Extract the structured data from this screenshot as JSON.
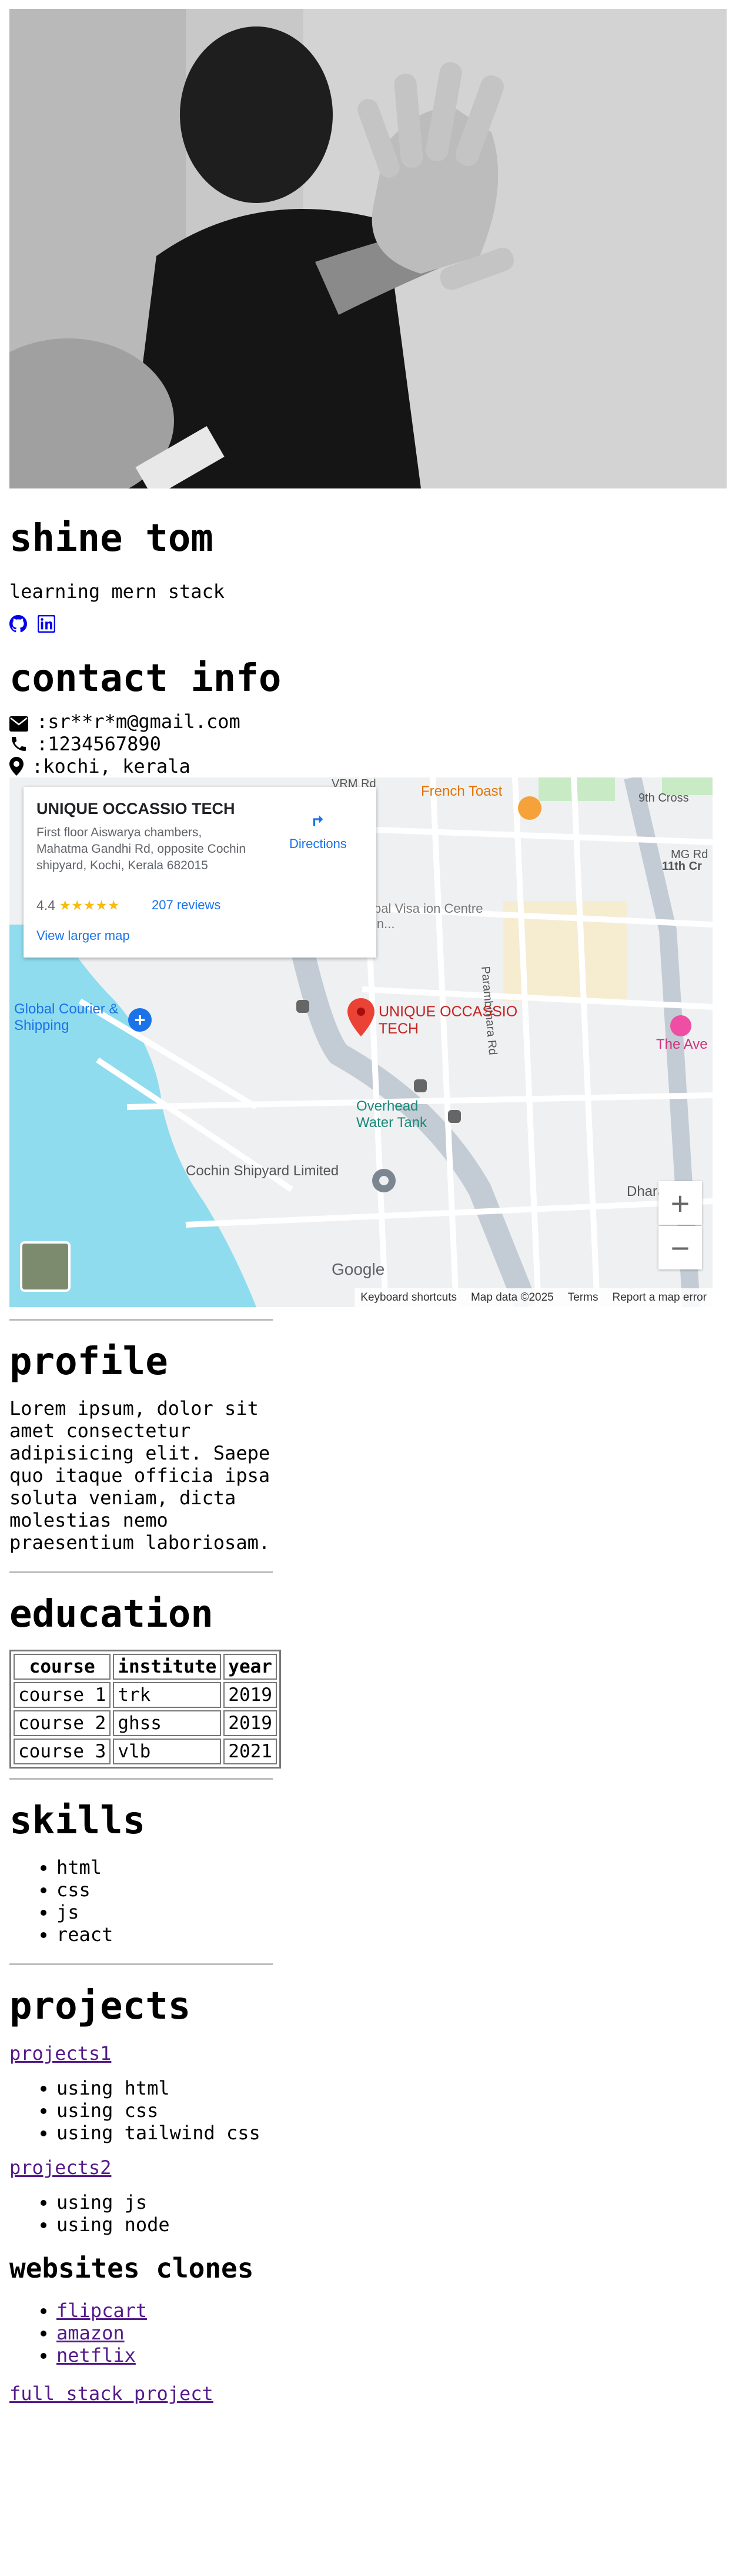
{
  "profile_header": {
    "name": "shine tom",
    "tagline": "learning mern stack"
  },
  "social": [
    {
      "icon": "github-icon",
      "color": "#0000ee"
    },
    {
      "icon": "linkedin-icon",
      "color": "#0000ee"
    }
  ],
  "contact": {
    "heading": "contact info",
    "email": ":sr**r*m@gmail.com",
    "phone": ":1234567890",
    "location": ":kochi, kerala"
  },
  "map": {
    "place_name": "UNIQUE OCCASSIO TECH",
    "address": "First floor Aiswarya chambers, Mahatma Gandhi Rd, opposite Cochin shipyard, Kochi, Kerala 682015",
    "rating": "4.4",
    "stars": "★★★★★",
    "reviews": "207 reviews",
    "directions": "Directions",
    "larger_map": "View larger map",
    "pin_label": "UNIQUE OCCASSIO TECH",
    "labels": {
      "french_toast": "French Toast",
      "global_courier": "Global Courier & Shipping",
      "overhead_tank": "Overhead Water Tank",
      "cochin_shipyard": "Cochin Shipyard Limited",
      "parambithara": "Parambithara Rd",
      "dharambi": "Dharambi",
      "the_ave": "The Ave",
      "mg_rd": "MG Rd",
      "ninth_cross": "9th Cross",
      "eleventh_cr": "11th Cr",
      "vrm_rd": "VRM Rd",
      "visa_centre": "bal Visa ion Centre in..."
    },
    "footer": {
      "keyboard": "Keyboard shortcuts",
      "data": "Map data ©2025",
      "terms": "Terms",
      "report": "Report a map error"
    },
    "google": "Google"
  },
  "profile": {
    "heading": "profile",
    "text": "Lorem ipsum, dolor sit amet consectetur adipisicing elit. Saepe quo itaque officia ipsa soluta veniam, dicta molestias nemo praesentium laboriosam."
  },
  "education": {
    "heading": "education",
    "columns": [
      "course",
      "institute",
      "year"
    ],
    "rows": [
      [
        "course 1",
        "trk",
        "2019"
      ],
      [
        "course 2",
        "ghss",
        "2019"
      ],
      [
        "course 3",
        "vlb",
        "2021"
      ]
    ]
  },
  "skills": {
    "heading": "skills",
    "items": [
      "html",
      "css",
      "js",
      "react"
    ]
  },
  "projects": {
    "heading": "projects",
    "project1": {
      "link": "projects1",
      "items": [
        "using html",
        "using css",
        "using tailwind css"
      ]
    },
    "project2": {
      "link": "projects2",
      "items": [
        "using js",
        "using node"
      ]
    }
  },
  "clones": {
    "heading": "websites clones",
    "items": [
      "flipcart",
      "amazon",
      "netflix"
    ]
  },
  "full_stack": "full stack project"
}
